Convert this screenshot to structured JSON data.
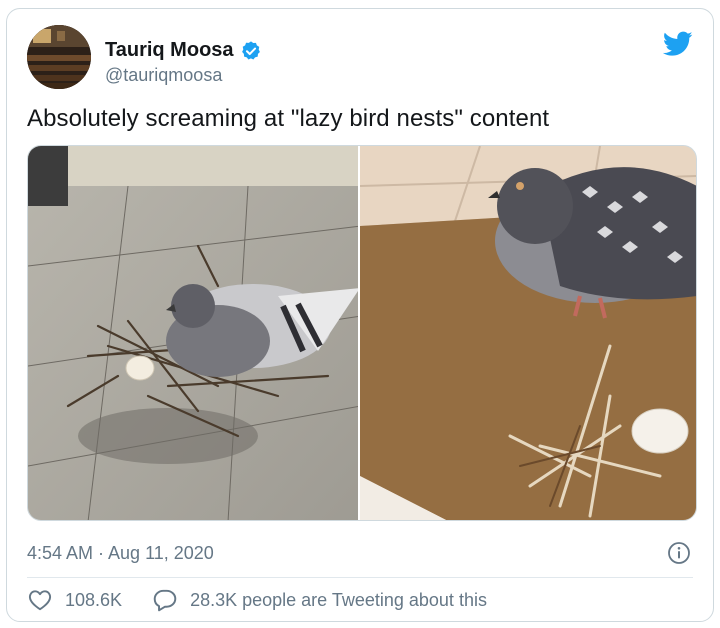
{
  "author": {
    "name": "Tauriq Moosa",
    "handle": "@tauriqmoosa",
    "verified": true,
    "avatar_icon": "avatar-photo"
  },
  "brand": {
    "logo_icon": "twitter-bird-icon",
    "color": "#1da1f2"
  },
  "tweet": {
    "text": "Absolutely screaming at \"lazy bird nests\" content",
    "media": [
      {
        "alt_icon": "pigeon-on-pavement-photo"
      },
      {
        "alt_icon": "pigeon-on-doormat-photo"
      }
    ],
    "timestamp": "4:54 AM · Aug 11, 2020"
  },
  "stats": {
    "likes": "108.6K",
    "conversation": "28.3K people are Tweeting about this"
  },
  "colors": {
    "text": "#14171a",
    "muted": "#657786",
    "border": "#cfd9de",
    "verified": "#1da1f2"
  }
}
